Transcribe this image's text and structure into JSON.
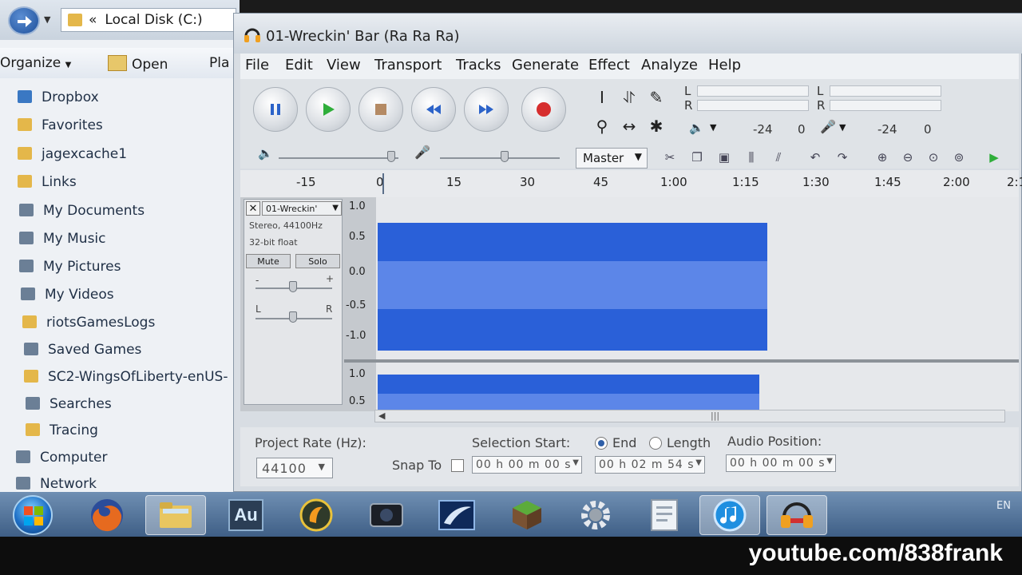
{
  "explorer": {
    "address": "Local Disk (C:)",
    "address_prefix": "«",
    "toolbar": {
      "organize": "Organize",
      "open": "Open",
      "play_partial": "Pla"
    },
    "nav_items": [
      {
        "label": "Dropbox",
        "icon": "dropbox-icon"
      },
      {
        "label": "Favorites",
        "icon": "folder-icon"
      },
      {
        "label": "jagexcache1",
        "icon": "folder-icon"
      },
      {
        "label": "Links",
        "icon": "folder-icon"
      },
      {
        "label": "My Documents",
        "icon": "documents-icon"
      },
      {
        "label": "My Music",
        "icon": "music-folder-icon"
      },
      {
        "label": "My Pictures",
        "icon": "pictures-folder-icon"
      },
      {
        "label": "My Videos",
        "icon": "videos-folder-icon"
      },
      {
        "label": "riotsGamesLogs",
        "icon": "folder-icon"
      },
      {
        "label": "Saved Games",
        "icon": "saved-games-icon"
      },
      {
        "label": "SC2-WingsOfLiberty-enUS-",
        "icon": "folder-icon"
      },
      {
        "label": "Searches",
        "icon": "search-folder-icon"
      },
      {
        "label": "Tracing",
        "icon": "folder-icon"
      },
      {
        "label": "Computer",
        "icon": "computer-icon"
      },
      {
        "label": "Network",
        "icon": "network-icon"
      }
    ]
  },
  "audacity": {
    "title": "01-Wreckin' Bar (Ra Ra Ra)",
    "menu": [
      "File",
      "Edit",
      "View",
      "Transport",
      "Tracks",
      "Generate",
      "Effect",
      "Analyze",
      "Help"
    ],
    "meters": {
      "lr_left": [
        "L",
        "R"
      ],
      "lr_right": [
        "L",
        "R"
      ],
      "scale_play": [
        "-24",
        "0"
      ],
      "scale_rec": [
        "-24",
        "0"
      ]
    },
    "device": "Master",
    "timeline": [
      "-15",
      "0",
      "15",
      "30",
      "45",
      "1:00",
      "1:15",
      "1:30",
      "1:45",
      "2:00",
      "2:1"
    ],
    "track": {
      "name": "01-Wreckin'",
      "info_1": "Stereo, 44100Hz",
      "info_2": "32-bit float",
      "mute": "Mute",
      "solo": "Solo",
      "gain_minus": "-",
      "gain_plus": "+",
      "pan_l": "L",
      "pan_r": "R",
      "scale_1": [
        "1.0",
        "0.5",
        "0.0",
        "-0.5",
        "-1.0"
      ],
      "scale_2": [
        "1.0",
        "0.5"
      ]
    },
    "selection": {
      "project_rate_label": "Project Rate (Hz):",
      "project_rate": "44100",
      "snap_to": "Snap To",
      "selection_start_label": "Selection Start:",
      "end_label": "End",
      "length_label": "Length",
      "audio_position_label": "Audio Position:",
      "start_time": "00 h 00 m 00 s",
      "end_time": "00 h 02 m 54 s",
      "audio_position": "00 h 00 m 00 s"
    }
  },
  "taskbar": {
    "lang": "EN",
    "buttons": [
      "firefox-icon",
      "explorer-folder-icon",
      "audition-icon",
      "fl-studio-icon",
      "camera-app-icon",
      "starcraft-icon",
      "minecraft-icon",
      "settings-gear-icon",
      "document-app-icon",
      "itunes-icon",
      "audacity-icon"
    ],
    "audition_label": "Au"
  },
  "watermark": "youtube.com/838frank",
  "colors": {
    "waveform": "#2a60d8",
    "waveform_inner": "#5c86e8",
    "record": "#d62e2e",
    "play": "#2fae3a"
  }
}
